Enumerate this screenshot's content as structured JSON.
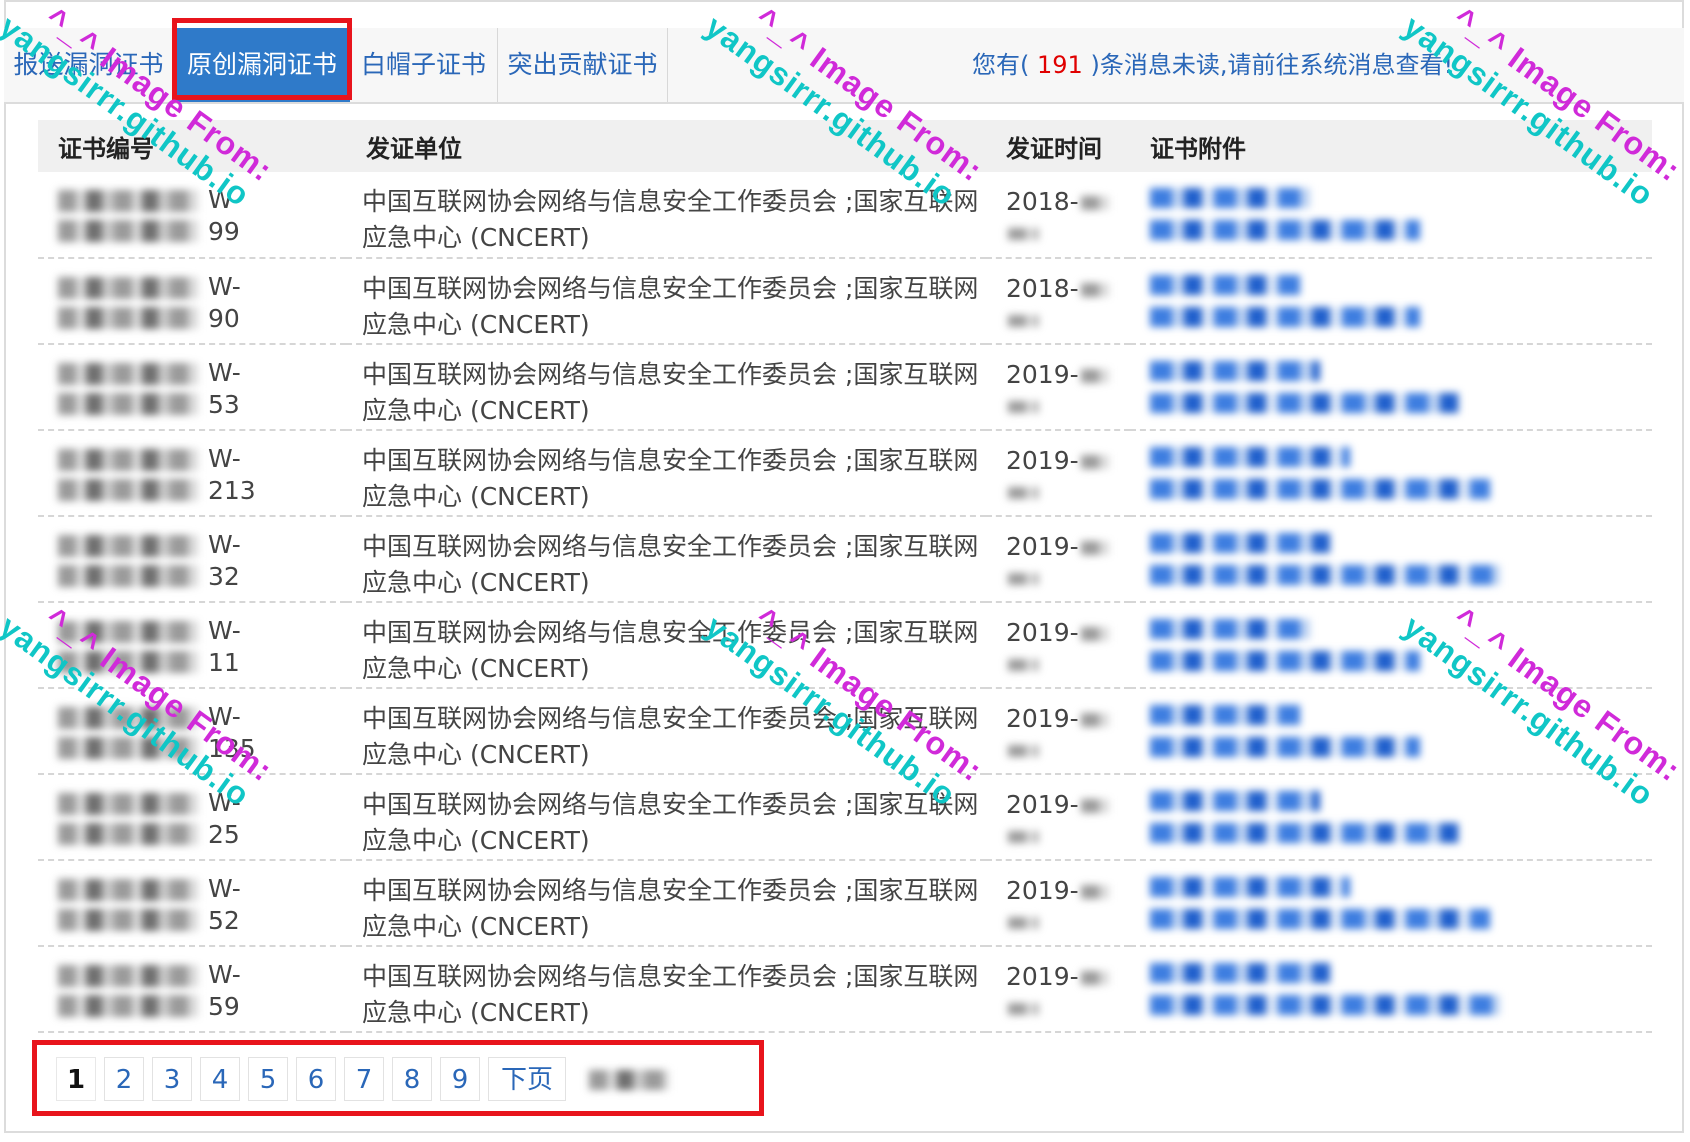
{
  "tabs": [
    {
      "label": "报送漏洞证书",
      "active": false
    },
    {
      "label": "原创漏洞证书",
      "active": true
    },
    {
      "label": "白帽子证书",
      "active": false
    },
    {
      "label": "突出贡献证书",
      "active": false
    }
  ],
  "notice": {
    "prefix": "您有(",
    "count": "191",
    "suffix": ")条消息未读,请前往系统消息查看!"
  },
  "table": {
    "headers": [
      "证书编号",
      "发证单位",
      "发证时间",
      "证书附件"
    ],
    "rows": [
      {
        "id_suffix_1": "W-",
        "id_suffix_2": "99",
        "issuer_line1": "中国互联网协会网络与信息安全工作委员会 ;国家互联网",
        "issuer_line2": "应急中心 (CNCERT)",
        "date": "2018-"
      },
      {
        "id_suffix_1": "W-",
        "id_suffix_2": "90",
        "issuer_line1": "中国互联网协会网络与信息安全工作委员会 ;国家互联网",
        "issuer_line2": "应急中心 (CNCERT)",
        "date": "2018-"
      },
      {
        "id_suffix_1": "W-",
        "id_suffix_2": "53",
        "issuer_line1": "中国互联网协会网络与信息安全工作委员会 ;国家互联网",
        "issuer_line2": "应急中心 (CNCERT)",
        "date": "2019-"
      },
      {
        "id_suffix_1": "W-",
        "id_suffix_2": "213",
        "issuer_line1": "中国互联网协会网络与信息安全工作委员会 ;国家互联网",
        "issuer_line2": "应急中心 (CNCERT)",
        "date": "2019-"
      },
      {
        "id_suffix_1": "W-",
        "id_suffix_2": "32",
        "issuer_line1": "中国互联网协会网络与信息安全工作委员会 ;国家互联网",
        "issuer_line2": "应急中心 (CNCERT)",
        "date": "2019-"
      },
      {
        "id_suffix_1": "W-",
        "id_suffix_2": "11",
        "issuer_line1": "中国互联网协会网络与信息安全工作委员会 ;国家互联网",
        "issuer_line2": "应急中心 (CNCERT)",
        "date": "2019-"
      },
      {
        "id_suffix_1": "W-",
        "id_suffix_2": "135",
        "issuer_line1": "中国互联网协会网络与信息安全工作委员会 ;国家互联网",
        "issuer_line2": "应急中心 (CNCERT)",
        "date": "2019-"
      },
      {
        "id_suffix_1": "W-",
        "id_suffix_2": "25",
        "issuer_line1": "中国互联网协会网络与信息安全工作委员会 ;国家互联网",
        "issuer_line2": "应急中心 (CNCERT)",
        "date": "2019-"
      },
      {
        "id_suffix_1": "W-",
        "id_suffix_2": "52",
        "issuer_line1": "中国互联网协会网络与信息安全工作委员会 ;国家互联网",
        "issuer_line2": "应急中心 (CNCERT)",
        "date": "2019-"
      },
      {
        "id_suffix_1": "W-",
        "id_suffix_2": "59",
        "issuer_line1": "中国互联网协会网络与信息安全工作委员会 ;国家互联网",
        "issuer_line2": "应急中心 (CNCERT)",
        "date": "2019-"
      }
    ]
  },
  "pagination": {
    "pages": [
      "1",
      "2",
      "3",
      "4",
      "5",
      "6",
      "7",
      "8",
      "9"
    ],
    "current": "1",
    "next_label": "下页"
  },
  "watermark": {
    "part1": "^_^ Image From:",
    "part2": "yangsirrr.github.io"
  },
  "colors": {
    "accent": "#2f7ac9",
    "link": "#2a67b8",
    "highlight_box": "#e8141c",
    "unread_count": "#e00000"
  }
}
